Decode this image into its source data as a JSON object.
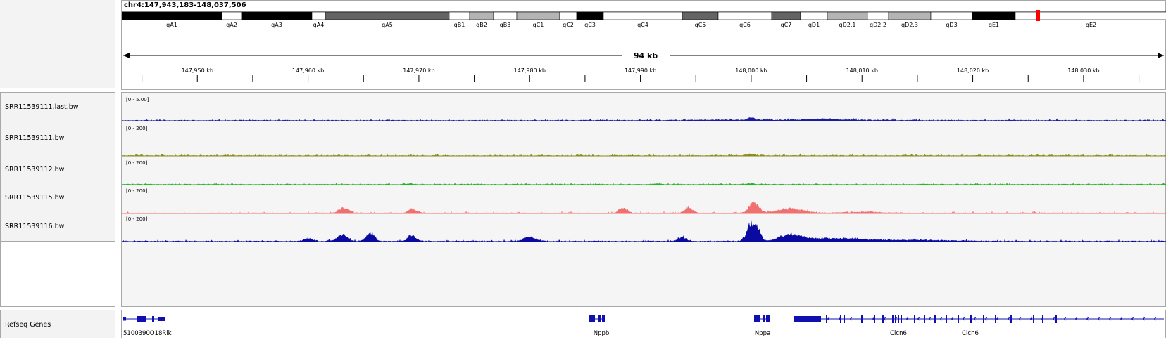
{
  "locus": "chr4:147,943,183-148,037,506",
  "ideogram": {
    "bands": [
      {
        "label": "qA1",
        "stain": "black"
      },
      {
        "label": "qA2",
        "stain": "white"
      },
      {
        "label": "qA3",
        "stain": "black"
      },
      {
        "label": "qA4",
        "stain": "white"
      },
      {
        "label": "qA5",
        "stain": "dark"
      },
      {
        "label": "qB1",
        "stain": "white"
      },
      {
        "label": "qB2",
        "stain": "light"
      },
      {
        "label": "qB3",
        "stain": "white"
      },
      {
        "label": "qC1",
        "stain": "light"
      },
      {
        "label": "qC2",
        "stain": "white"
      },
      {
        "label": "qC3",
        "stain": "black"
      },
      {
        "label": "qC4",
        "stain": "white"
      },
      {
        "label": "qC5",
        "stain": "dark"
      },
      {
        "label": "qC6",
        "stain": "white"
      },
      {
        "label": "qC7",
        "stain": "dark"
      },
      {
        "label": "qD1",
        "stain": "white"
      },
      {
        "label": "qD2.1",
        "stain": "light"
      },
      {
        "label": "qD2.2",
        "stain": "white"
      },
      {
        "label": "qD2.3",
        "stain": "light"
      },
      {
        "label": "qD3",
        "stain": "white"
      },
      {
        "label": "qE1",
        "stain": "black"
      },
      {
        "label": "qE2",
        "stain": "white"
      }
    ]
  },
  "ruler": {
    "span_label": "94 kb",
    "tick_labels": [
      "147,950 kb",
      "147,960 kb",
      "147,970 kb",
      "147,980 kb",
      "147,990 kb",
      "148,000 kb",
      "148,010 kb",
      "148,020 kb",
      "148,030 kb"
    ]
  },
  "tracks": [
    {
      "name": "SRR11539111.last.bw",
      "scale": "[0 - 5.00]",
      "color": "#1a1aa0"
    },
    {
      "name": "SRR11539111.bw",
      "scale": "[0 - 200]",
      "color": "#8b8b1a"
    },
    {
      "name": "SRR11539112.bw",
      "scale": "[0 - 200]",
      "color": "#22b422"
    },
    {
      "name": "SRR11539115.bw",
      "scale": "[0 - 200]",
      "color": "#f07070"
    },
    {
      "name": "SRR11539116.bw",
      "scale": "[0 - 200]",
      "color": "#0a0aa0"
    }
  ],
  "genes_track": {
    "name": "Refseq Genes",
    "color": "#1010b0",
    "genes": [
      {
        "label": "5100390O18Rik"
      },
      {
        "label": "Nppb"
      },
      {
        "label": "Nppa"
      },
      {
        "label": "Clcn6"
      },
      {
        "label": "Clcn6"
      }
    ]
  }
}
